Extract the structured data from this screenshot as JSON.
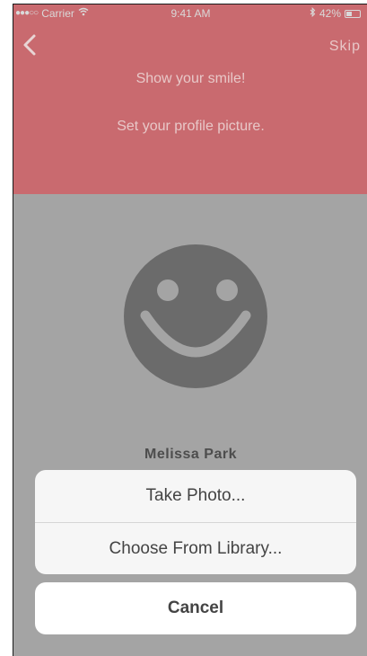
{
  "status_bar": {
    "carrier": "Carrier",
    "time": "9:41 AM",
    "battery": "42%",
    "battery_level": 0.42
  },
  "navigation": {
    "back_icon": "chevron-left-icon",
    "skip_label": "Skip"
  },
  "header": {
    "title": "Show your smile!",
    "subtitle": "Set your profile picture."
  },
  "profile": {
    "avatar_icon": "smiley-face-icon",
    "name": "Melissa Park"
  },
  "action_sheet": {
    "take_photo_label": "Take Photo...",
    "choose_library_label": "Choose From Library...",
    "cancel_label": "Cancel"
  },
  "colors": {
    "header_background": "#c96a6f",
    "overlay_background": "#a4a4a4",
    "avatar_color": "#6b6b6b"
  }
}
